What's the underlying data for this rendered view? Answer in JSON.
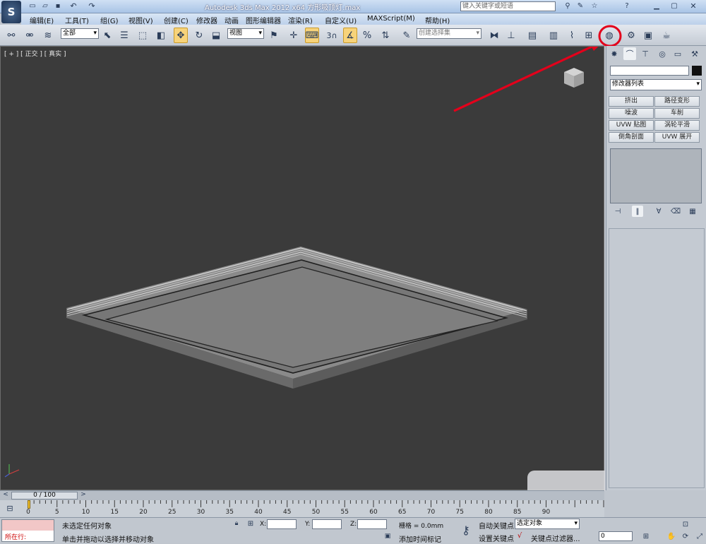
{
  "title_bar": {
    "title": "Autodesk 3ds Max  2012 x64      方形吸顶灯.max",
    "search_placeholder": "键入关键字或短语",
    "help_label": "?"
  },
  "menu": [
    "编辑(E)",
    "工具(T)",
    "组(G)",
    "视图(V)",
    "创建(C)",
    "修改器",
    "动画",
    "图形编辑器",
    "渲染(R)",
    "自定义(U)",
    "MAXScript(M)",
    "帮助(H)"
  ],
  "toolbar": {
    "selection_filter": "全部",
    "ref_coord": "视图",
    "named_selection": "创建选择集"
  },
  "viewport": {
    "label": "[ + ] [ 正交 ] [ 真实 ]"
  },
  "command_panel": {
    "modifier_list": "修改器列表",
    "modifier_buttons": [
      "挤出",
      "路径变形",
      "噪波",
      "车削",
      "UVW 贴图",
      "涡轮平滑",
      "倒角剖面",
      "UVW 展开"
    ]
  },
  "timeline": {
    "frame_counter": "0 / 100",
    "ticks": [
      0,
      5,
      10,
      15,
      20,
      25,
      30,
      35,
      40,
      45,
      50,
      55,
      60,
      65,
      70,
      75,
      80,
      85,
      90
    ]
  },
  "status": {
    "maxscript_label": "所在行:",
    "selection_msg": "未选定任何对象",
    "prompt_msg": "单击并拖动以选择并移动对象",
    "x_label": "X:",
    "y_label": "Y:",
    "z_label": "Z:",
    "grid_label": "栅格 = 0.0mm",
    "add_time_tag": "添加时间标记",
    "auto_key": "自动关键点",
    "set_key": "设置关键点",
    "selected_dropdown": "选定对象",
    "key_filter": "关键点过滤器...",
    "frame_value": "0"
  },
  "colors": {
    "viewport_bg": "#3b3b3b",
    "annotation": "#e3001b",
    "active_button": "#f7d37a"
  }
}
